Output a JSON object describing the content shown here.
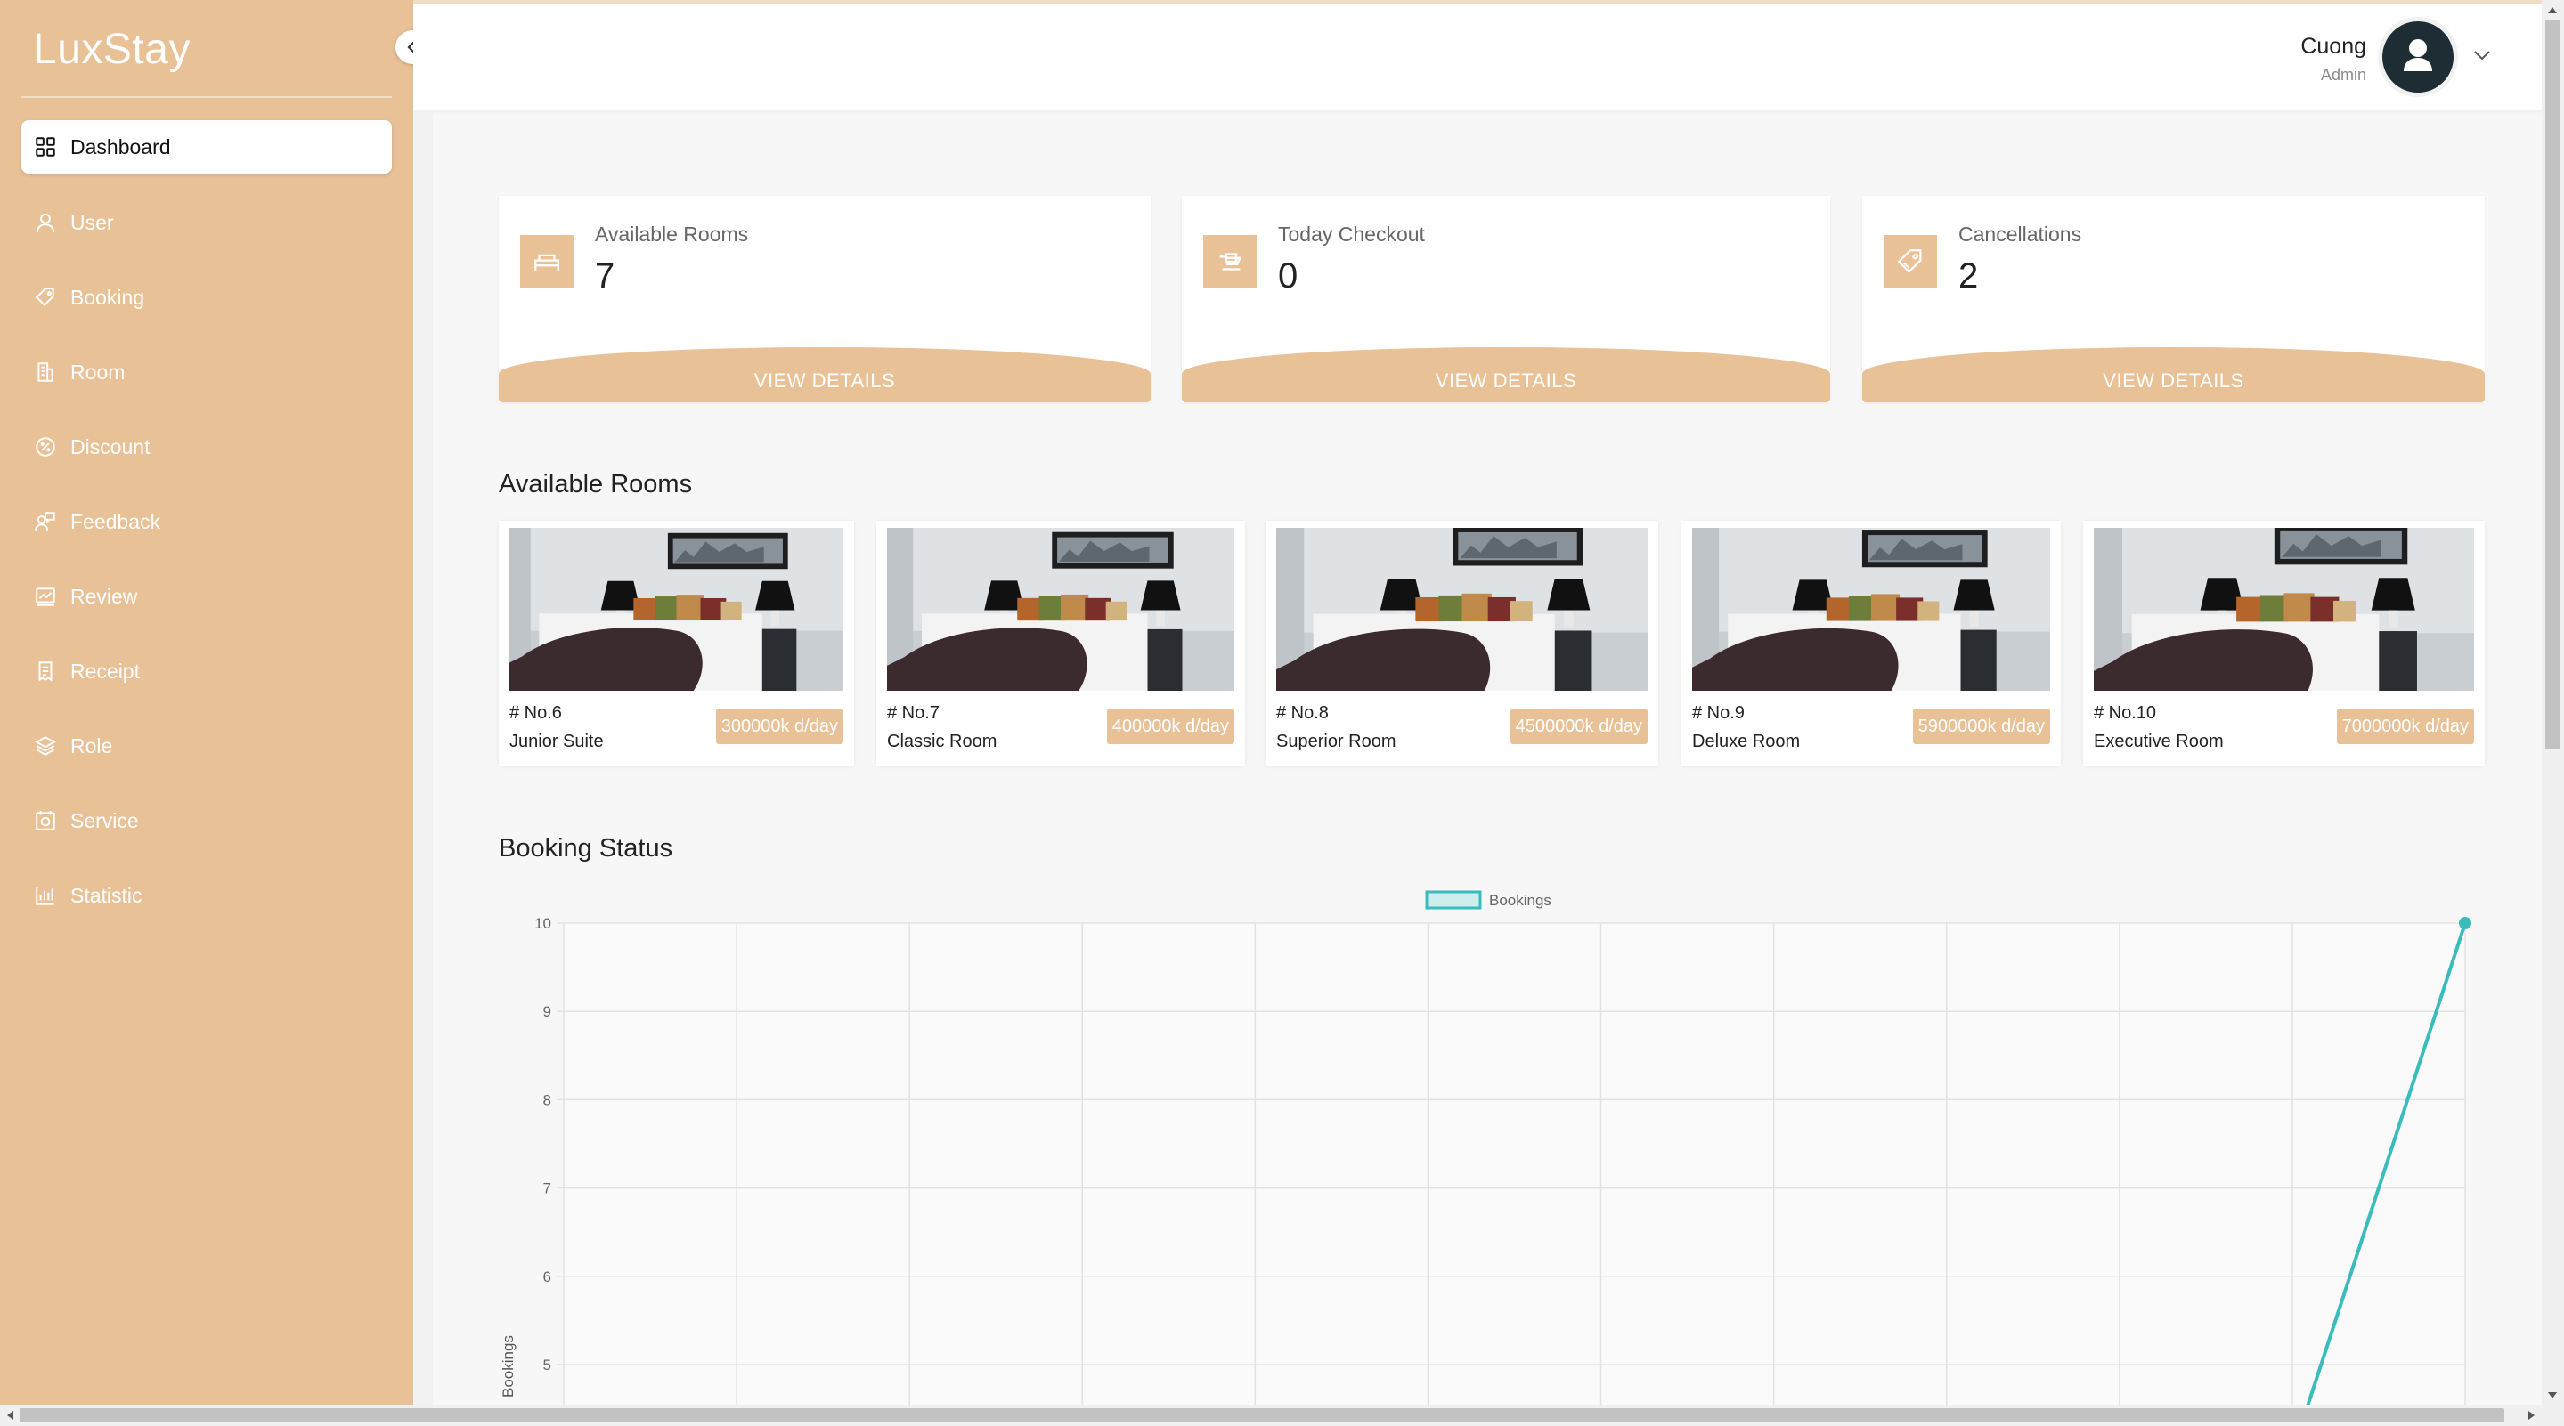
{
  "brand": "LuxStay",
  "nav": [
    {
      "label": "Dashboard",
      "icon": "grid-icon"
    },
    {
      "label": "User",
      "icon": "user-icon"
    },
    {
      "label": "Booking",
      "icon": "tag-icon"
    },
    {
      "label": "Room",
      "icon": "building-icon"
    },
    {
      "label": "Discount",
      "icon": "badge-icon"
    },
    {
      "label": "Feedback",
      "icon": "person-chat-icon"
    },
    {
      "label": "Review",
      "icon": "chart-card-icon"
    },
    {
      "label": "Receipt",
      "icon": "receipt-icon"
    },
    {
      "label": "Role",
      "icon": "layers-icon"
    },
    {
      "label": "Service",
      "icon": "gallery-icon"
    },
    {
      "label": "Statistic",
      "icon": "bar-chart-icon"
    }
  ],
  "header": {
    "user_name": "Cuong",
    "user_role": "Admin"
  },
  "stats": [
    {
      "label": "Available Rooms",
      "value": "7",
      "button": "VIEW DETAILS",
      "icon": "bed-icon"
    },
    {
      "label": "Today Checkout",
      "value": "0",
      "button": "VIEW DETAILS",
      "icon": "checkout-icon"
    },
    {
      "label": "Cancellations",
      "value": "2",
      "button": "VIEW DETAILS",
      "icon": "tag-icon"
    }
  ],
  "sections": {
    "available_rooms": "Available Rooms",
    "booking_status": "Booking Status"
  },
  "rooms": [
    {
      "number": "# No.6",
      "type": "Junior Suite",
      "price": "300000k d/day"
    },
    {
      "number": "# No.7",
      "type": "Classic Room",
      "price": "400000k d/day"
    },
    {
      "number": "# No.8",
      "type": "Superior Room",
      "price": "4500000k d/day"
    },
    {
      "number": "# No.9",
      "type": "Deluxe Room",
      "price": "5900000k d/day"
    },
    {
      "number": "# No.10",
      "type": "Executive Room",
      "price": "7000000k d/day"
    }
  ],
  "colors": {
    "accent": "#e8c197",
    "line": "#3bbcbc"
  },
  "chart_data": {
    "type": "line",
    "title": "",
    "xlabel": "",
    "ylabel": "Bookings",
    "legend": "top-center",
    "grid": true,
    "ylim_visible": [
      4.5,
      10
    ],
    "y_ticks": [
      "10",
      "9",
      "8",
      "7",
      "6",
      "5"
    ],
    "series": [
      {
        "name": "Bookings",
        "x_index": [
          10,
          11
        ],
        "values": [
          4,
          10
        ]
      }
    ],
    "x_categories_count": 12
  }
}
